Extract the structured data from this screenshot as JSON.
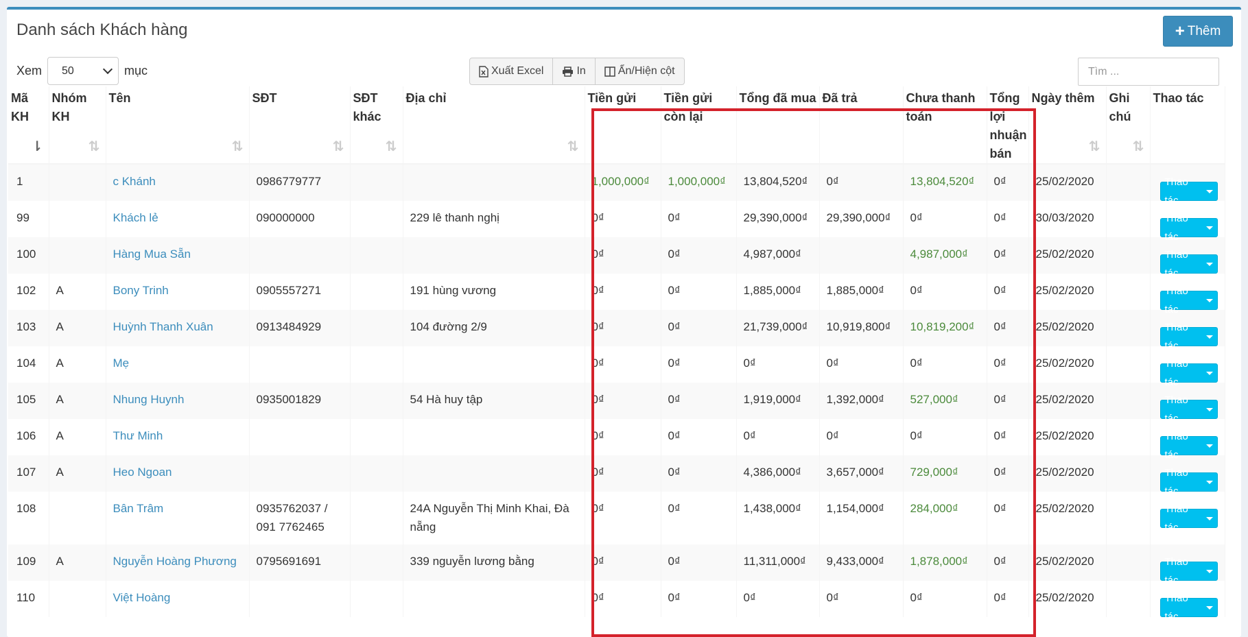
{
  "page": {
    "title": "Danh sách Khách hàng",
    "add_label": "Thêm",
    "length_prefix": "Xem",
    "length_value": "50",
    "length_suffix": "mục",
    "export_label": "Xuất Excel",
    "print_label": "In",
    "columns_label": "Ẩn/Hiện cột",
    "search_placeholder": "Tìm ..."
  },
  "colors": {
    "accent": "#3c8dbc",
    "action": "#00c0ef",
    "positive": "#4b8a3b",
    "highlight": "#d4222b"
  },
  "headers": [
    "Mã KH",
    "Nhóm KH",
    "Tên",
    "SĐT",
    "SĐT khác",
    "Địa chỉ",
    "Tiền gửi",
    "Tiền gửi còn lại",
    "Tổng đã mua",
    "Đã trả",
    "Chưa thanh toán",
    "Tổng lợi nhuận bán",
    "Ngày thêm",
    "Ghi chú",
    "Thao tác"
  ],
  "action_label": "Thao tác",
  "rows": [
    {
      "id": "1",
      "group": "",
      "name": "c Khánh",
      "phone": "0986779777",
      "phone2": "",
      "address": "",
      "deposit": "1,000,000₫",
      "deposit_left": "1,000,000₫",
      "total": "13,804,520₫",
      "paid": "0₫",
      "unpaid": "13,804,520₫",
      "profit": "0₫",
      "date": "25/02/2020",
      "note": ""
    },
    {
      "id": "99",
      "group": "",
      "name": "Khách lẻ",
      "phone": "090000000",
      "phone2": "",
      "address": "229 lê thanh nghị",
      "deposit": "0₫",
      "deposit_left": "0₫",
      "total": "29,390,000₫",
      "paid": "29,390,000₫",
      "unpaid": "0₫",
      "profit": "0₫",
      "date": "30/03/2020",
      "note": ""
    },
    {
      "id": "100",
      "group": "",
      "name": "Hàng Mua Sẵn",
      "phone": "",
      "phone2": "",
      "address": "",
      "deposit": "0₫",
      "deposit_left": "0₫",
      "total": "4,987,000₫",
      "paid": "",
      "unpaid": "4,987,000₫",
      "profit": "0₫",
      "date": "25/02/2020",
      "note": ""
    },
    {
      "id": "102",
      "group": "A",
      "name": "Bony Trinh",
      "phone": "0905557271",
      "phone2": "",
      "address": "191 hùng vương",
      "deposit": "0₫",
      "deposit_left": "0₫",
      "total": "1,885,000₫",
      "paid": "1,885,000₫",
      "unpaid": "0₫",
      "profit": "0₫",
      "date": "25/02/2020",
      "note": ""
    },
    {
      "id": "103",
      "group": "A",
      "name": "Huỳnh Thanh Xuân",
      "phone": "0913484929",
      "phone2": "",
      "address": "104 đường 2/9",
      "deposit": "0₫",
      "deposit_left": "0₫",
      "total": "21,739,000₫",
      "paid": "10,919,800₫",
      "unpaid": "10,819,200₫",
      "profit": "0₫",
      "date": "25/02/2020",
      "note": ""
    },
    {
      "id": "104",
      "group": "A",
      "name": "Mẹ",
      "phone": "",
      "phone2": "",
      "address": "",
      "deposit": "0₫",
      "deposit_left": "0₫",
      "total": "0₫",
      "paid": "0₫",
      "unpaid": "0₫",
      "profit": "0₫",
      "date": "25/02/2020",
      "note": ""
    },
    {
      "id": "105",
      "group": "A",
      "name": "Nhung Huynh",
      "phone": "0935001829",
      "phone2": "",
      "address": "54 Hà huy tập",
      "deposit": "0₫",
      "deposit_left": "0₫",
      "total": "1,919,000₫",
      "paid": "1,392,000₫",
      "unpaid": "527,000₫",
      "profit": "0₫",
      "date": "25/02/2020",
      "note": ""
    },
    {
      "id": "106",
      "group": "A",
      "name": "Thư Minh",
      "phone": "",
      "phone2": "",
      "address": "",
      "deposit": "0₫",
      "deposit_left": "0₫",
      "total": "0₫",
      "paid": "0₫",
      "unpaid": "0₫",
      "profit": "0₫",
      "date": "25/02/2020",
      "note": ""
    },
    {
      "id": "107",
      "group": "A",
      "name": "Heo Ngoan",
      "phone": "",
      "phone2": "",
      "address": "",
      "deposit": "0₫",
      "deposit_left": "0₫",
      "total": "4,386,000₫",
      "paid": "3,657,000₫",
      "unpaid": "729,000₫",
      "profit": "0₫",
      "date": "25/02/2020",
      "note": ""
    },
    {
      "id": "108",
      "group": "",
      "name": "Bân Trâm",
      "phone": "0935762037 / 091 7762465",
      "phone2": "",
      "address": "24A Nguyễn Thị Minh Khai, Đà nẵng",
      "deposit": "0₫",
      "deposit_left": "0₫",
      "total": "1,438,000₫",
      "paid": "1,154,000₫",
      "unpaid": "284,000₫",
      "profit": "0₫",
      "date": "25/02/2020",
      "note": ""
    },
    {
      "id": "109",
      "group": "A",
      "name": "Nguyễn Hoàng Phương",
      "phone": "0795691691",
      "phone2": "",
      "address": "339 nguyễn lương bằng",
      "deposit": "0₫",
      "deposit_left": "0₫",
      "total": "11,311,000₫",
      "paid": "9,433,000₫",
      "unpaid": "1,878,000₫",
      "profit": "0₫",
      "date": "25/02/2020",
      "note": ""
    },
    {
      "id": "110",
      "group": "",
      "name": "Việt Hoàng",
      "phone": "",
      "phone2": "",
      "address": "",
      "deposit": "0₫",
      "deposit_left": "0₫",
      "total": "0₫",
      "paid": "0₫",
      "unpaid": "0₫",
      "profit": "0₫",
      "date": "25/02/2020",
      "note": ""
    }
  ]
}
